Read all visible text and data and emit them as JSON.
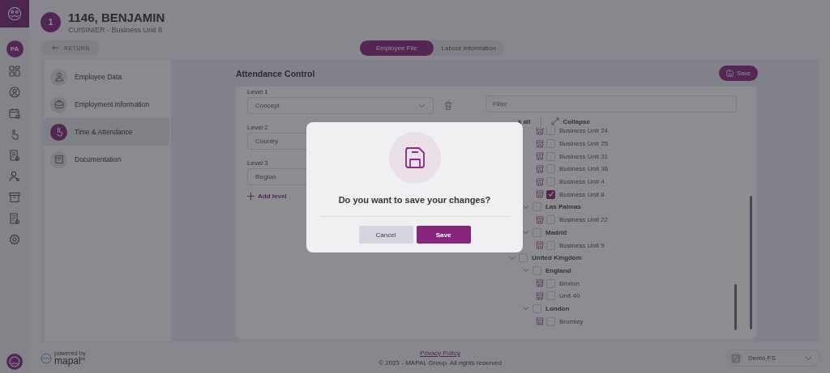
{
  "rail": {
    "avatar": "PA"
  },
  "employee": {
    "number": "1",
    "name": "1146, BENJAMIN",
    "subtitle": "CUISINIER - Business Unit 8"
  },
  "return_button": "RETURN",
  "tabs": [
    {
      "label": "Employee File",
      "selected": true
    },
    {
      "label": "Labour Information",
      "selected": false
    }
  ],
  "nav": [
    {
      "label": "Employee Data",
      "kind": "person",
      "selected": false
    },
    {
      "label": "Employment Information",
      "kind": "briefcase",
      "selected": false
    },
    {
      "label": "Time & Attendance",
      "kind": "hand",
      "selected": true
    },
    {
      "label": "Documentation",
      "kind": "archive",
      "selected": false
    }
  ],
  "section_title": "Attendance Control",
  "save_button": "Save",
  "levels": [
    {
      "label": "Level 1",
      "value": "Concept",
      "removable": true
    },
    {
      "label": "Level 2",
      "value": "Country"
    },
    {
      "label": "Level 3",
      "value": "Region"
    }
  ],
  "add_level": "Add level",
  "filter": {
    "placeholder": "Filter"
  },
  "check_all": "k all",
  "collapse": "Collapse",
  "tree": [
    {
      "children": [
        {
          "children": [
            {
              "label": "Business Unit 24",
              "kind": "unit",
              "checked": false
            },
            {
              "label": "Business Unit 25",
              "kind": "unit",
              "checked": false
            },
            {
              "label": "Business Unit 31",
              "kind": "unit",
              "checked": false
            },
            {
              "label": "Business Unit 36",
              "kind": "unit",
              "checked": false
            },
            {
              "label": "Business Unit 4",
              "kind": "unit",
              "checked": false
            },
            {
              "label": "Business Unit 8",
              "kind": "unit",
              "checked": true
            }
          ]
        },
        {
          "label": "Las Palmas",
          "kind": "group",
          "checked": false,
          "expanded": true,
          "children": [
            {
              "label": "Business Unit 22",
              "kind": "unit",
              "checked": false
            }
          ]
        },
        {
          "label": "Madrid",
          "kind": "group",
          "checked": false,
          "expanded": true,
          "children": [
            {
              "label": "Business Unit 9",
              "kind": "unit",
              "checked": false
            }
          ]
        }
      ]
    },
    {
      "label": "United Kingdom",
      "kind": "group",
      "checked": false,
      "expanded": true,
      "children": [
        {
          "label": "England",
          "kind": "group",
          "checked": false,
          "expanded": true,
          "children": [
            {
              "label": "Brixton",
              "kind": "unit",
              "checked": false
            },
            {
              "label": "Unit 40",
              "kind": "unit",
              "checked": false
            }
          ]
        },
        {
          "label": "London",
          "kind": "group",
          "checked": false,
          "expanded": true,
          "children": [
            {
              "label": "Bromley",
              "kind": "unit",
              "checked": false
            }
          ]
        }
      ]
    }
  ],
  "footer": {
    "powered_by": "powered by",
    "brand": "mapal",
    "brand_suffix": "os",
    "privacy": "Privacy Policy",
    "copyright": "© 2025 - MAPAL Group. All rights reserved",
    "site": "Demo FS"
  },
  "dialog": {
    "question": "Do you want to save your changes?",
    "buttons": [
      {
        "label": "Cancel",
        "kind": "secondary"
      },
      {
        "label": "Save",
        "kind": "primary"
      }
    ]
  }
}
